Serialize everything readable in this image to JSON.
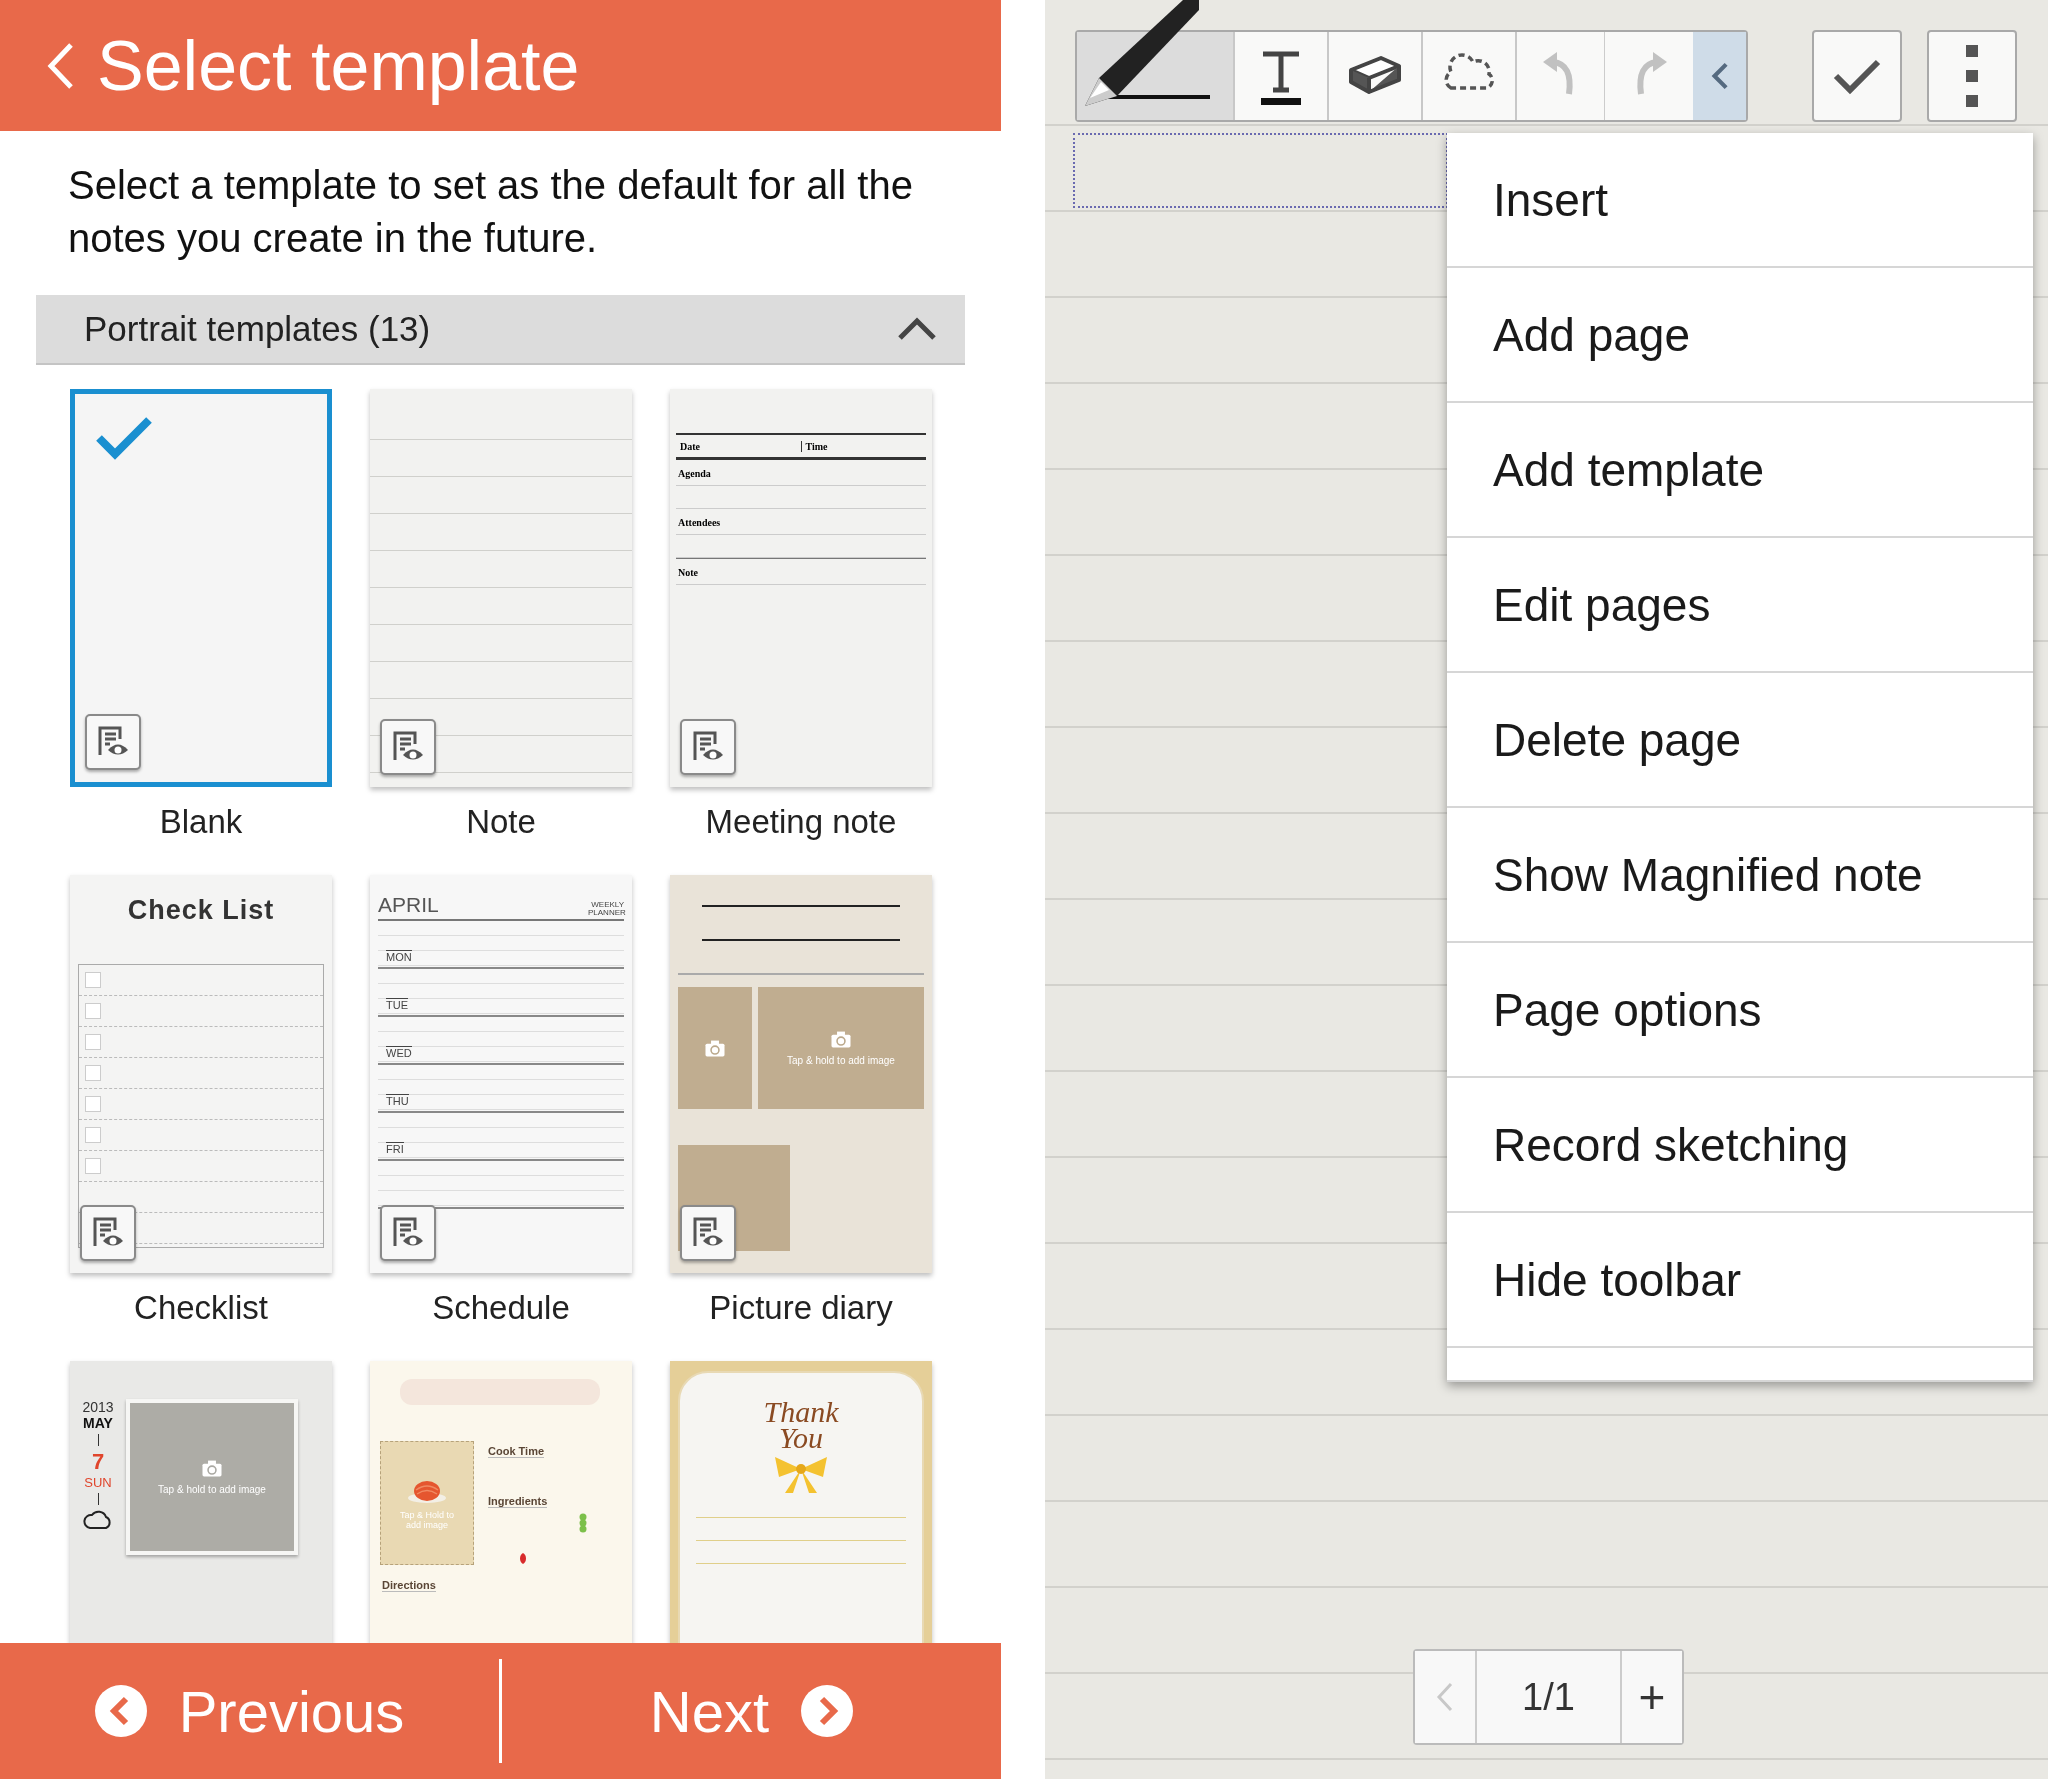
{
  "template_screen": {
    "title": "Select template",
    "description": "Select a template to set as the default for all the notes you create in the future.",
    "section": {
      "label": "Portrait templates (13)",
      "expanded": true
    },
    "templates": [
      {
        "name": "Blank",
        "selected": true,
        "kind": "blank"
      },
      {
        "name": "Note",
        "selected": false,
        "kind": "lined"
      },
      {
        "name": "Meeting note",
        "selected": false,
        "kind": "meeting",
        "fields": [
          "Date",
          "Time"
        ],
        "sections": [
          "Agenda",
          "Attendees",
          "Note"
        ]
      },
      {
        "name": "Checklist",
        "selected": false,
        "kind": "checklist",
        "title": "Check List",
        "boxes": [
          {
            "checked": false
          },
          {
            "checked": false
          },
          {
            "checked": false
          },
          {
            "checked": false
          },
          {
            "checked": false
          },
          {
            "checked": false
          },
          {
            "checked": false
          }
        ]
      },
      {
        "name": "Schedule",
        "selected": false,
        "kind": "schedule",
        "month": "APRIL",
        "subtitle": "WEEKLY PLANNER",
        "days": [
          "MON",
          "TUE",
          "WED",
          "THU",
          "FRI"
        ]
      },
      {
        "name": "Picture diary",
        "selected": false,
        "kind": "diary",
        "caption": "Tap & hold to add image"
      },
      {
        "selected": false,
        "kind": "calendar",
        "year": "2013",
        "month": "MAY",
        "day": "7",
        "weekday": "SUN",
        "caption": "Tap & hold to add image"
      },
      {
        "selected": false,
        "kind": "recipe",
        "caption": "Tap & Hold to add image",
        "sections": [
          "Cook Time",
          "Ingredients",
          "Directions"
        ]
      },
      {
        "selected": false,
        "kind": "card",
        "greeting": "Thank You"
      }
    ],
    "buttons": [
      {
        "label": "Previous",
        "kind": "previous"
      },
      {
        "label": "Next",
        "kind": "next"
      }
    ]
  },
  "note_screen": {
    "tools": [
      {
        "kind": "pen",
        "selected": true,
        "disabled": false
      },
      {
        "kind": "text",
        "selected": false,
        "disabled": false
      },
      {
        "kind": "eraser",
        "selected": false,
        "disabled": false
      },
      {
        "kind": "lasso",
        "selected": false,
        "disabled": false
      },
      {
        "kind": "undo",
        "selected": false,
        "disabled": true
      },
      {
        "kind": "redo",
        "selected": false,
        "disabled": true
      },
      {
        "kind": "collapse",
        "selected": false,
        "disabled": false
      }
    ],
    "actions": [
      {
        "kind": "done"
      },
      {
        "kind": "more"
      }
    ],
    "menu": [
      "Insert",
      "Add page",
      "Add template",
      "Edit pages",
      "Delete page",
      "Show Magnified note",
      "Page options",
      "Record sketching",
      "Hide toolbar"
    ],
    "page_nav": {
      "prev_disabled": true,
      "page": "1/1",
      "add": "+"
    }
  }
}
